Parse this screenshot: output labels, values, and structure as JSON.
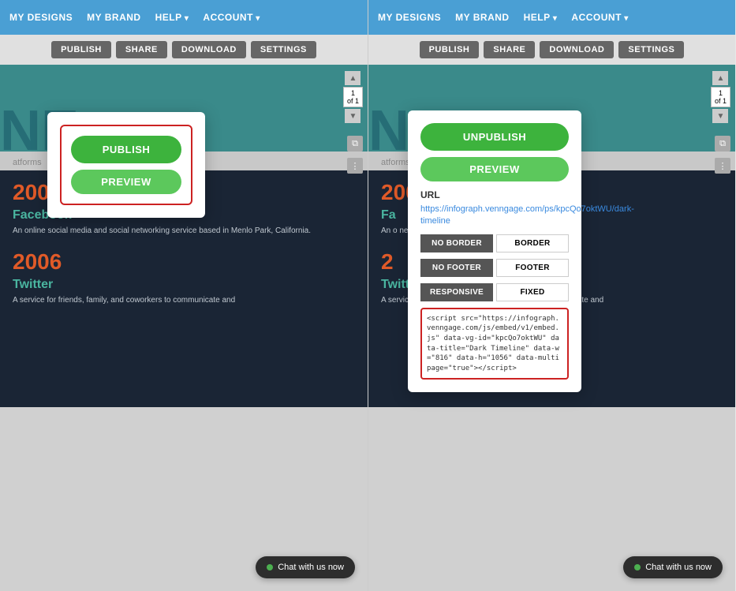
{
  "panels": [
    {
      "id": "left",
      "nav": {
        "items": [
          {
            "label": "MY DESIGNS",
            "hasArrow": false
          },
          {
            "label": "MY BRAND",
            "hasArrow": false
          },
          {
            "label": "HELP",
            "hasArrow": true
          },
          {
            "label": "ACCOUNT",
            "hasArrow": true
          }
        ]
      },
      "toolbar": {
        "buttons": [
          "PUBLISH",
          "SHARE",
          "DOWNLOAD",
          "SETTINGS"
        ]
      },
      "popup": {
        "type": "publish",
        "publishLabel": "PUBLISH",
        "previewLabel": "PREVIEW"
      },
      "design": {
        "headerLetters": "NE",
        "platformsText": "atforms",
        "year1": "2004",
        "brand1": "Facebook",
        "desc1": "An online social media and social networking service based in Menlo Park, California.",
        "year2": "2006",
        "brand2": "Twitter",
        "desc2": "A service for friends, family, and coworkers to communicate and"
      },
      "scrollPage": "1",
      "scrollOf": "of 1",
      "chat": {
        "label": "Chat with us now"
      }
    },
    {
      "id": "right",
      "nav": {
        "items": [
          {
            "label": "MY DESIGNS",
            "hasArrow": false
          },
          {
            "label": "MY BRAND",
            "hasArrow": false
          },
          {
            "label": "HELP",
            "hasArrow": true
          },
          {
            "label": "ACCOUNT",
            "hasArrow": true
          }
        ]
      },
      "toolbar": {
        "buttons": [
          "PUBLISH",
          "SHARE",
          "DOWNLOAD",
          "SETTINGS"
        ]
      },
      "popup": {
        "type": "share",
        "unpublishLabel": "UNPUBLISH",
        "previewLabel": "PREVIEW",
        "urlLabel": "URL",
        "urlLink": "https://infograph.venngage.com/ps/kpcQo7oktWU/dark-timeline",
        "toggles": {
          "border": [
            "NO BORDER",
            "BORDER"
          ],
          "footer": [
            "NO FOOTER",
            "FOOTER"
          ],
          "responsive": [
            "RESPONSIVE",
            "FIXED"
          ]
        },
        "embedCode": "<script src=\"https://infograph.venngage.com/js/embed/v1/embed.js\" data-vg-id=\"kpcQo7oktWU\" data-title=\"Dark Timeline\" data-w=\"816\" data-h=\"1056\" data-multipage=\"true\"></script>"
      },
      "design": {
        "headerLetters": "NE",
        "platformsText": "atforms",
        "year1": "2004",
        "brand1": "Fa",
        "desc1": "An o\nnet",
        "year2": "2",
        "brand2": "Twitter",
        "desc2": "A service for friends, family, and coworkers to communicate and"
      },
      "scrollPage": "1",
      "scrollOf": "of 1",
      "chat": {
        "label": "Chat with us now"
      }
    }
  ],
  "colors": {
    "navBg": "#4a9fd4",
    "green": "#3db33d",
    "red": "#cc2222",
    "teal": "#3a8a8a",
    "darkBg": "#1a2535",
    "year": "#e05a28",
    "brandColor": "#4ab5a0"
  }
}
